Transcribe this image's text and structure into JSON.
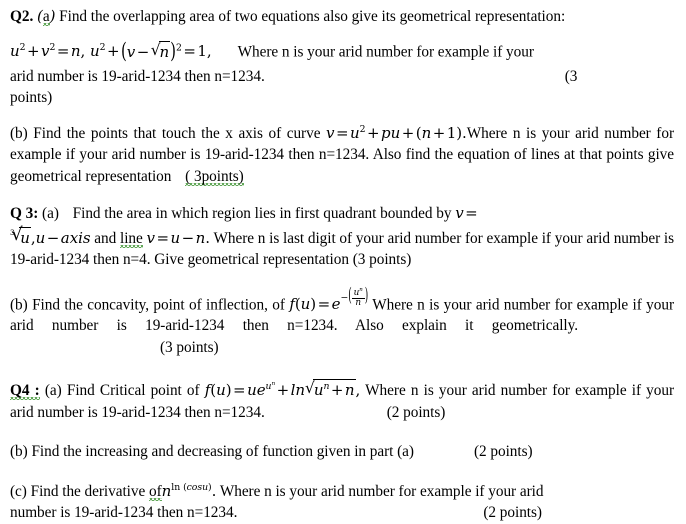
{
  "document": {
    "type": "math-assignment-questions",
    "questions": [
      {
        "id": "q2",
        "label": "Q2.",
        "part_label": "(a)",
        "text_before": "Find the overlapping area of two equations also give its geometrical representation:",
        "equation_plain": "u^2 + v^2 = n,  u^2 + (v - sqrt(n))^2 = 1,",
        "text_after": "Where n is your arid number for example if your arid number is 19-arid-1234 then n=1234.",
        "points": "(3 points)",
        "parts": [
          {
            "id": "q2b",
            "label": "(b)",
            "text_before": "Find the points that touch the x axis of curve",
            "equation_plain": "v = u^2 + pu + (n + 1).",
            "text_after": "Where n is your arid number for example if your arid number is 19-arid-1234 then n=1234. Also find the equation of lines at that points give geometrical representation",
            "points": "( 3points)"
          }
        ]
      },
      {
        "id": "q3",
        "label": "Q 3:",
        "part_label": "(a)",
        "text_before": "Find the area in which region lies in first quadrant bounded by",
        "equation_plain": "v = cbrt(u), u - axis and line v = u - n.",
        "text_after": "Where n is last digit of your arid number for example if your arid number is 19-arid-1234 then n=4. Give geometrical representation",
        "points": "(3 points)",
        "parts": [
          {
            "id": "q3b",
            "label": "(b)",
            "text_before": "Find the concavity, point of inflection, of",
            "equation_plain": "f(u) = e^(-(u^n/n))",
            "text_after": "Where n is your arid number for example if your arid number is 19-arid-1234 then n=1234. Also explain it geometrically.",
            "points": "(3 points)"
          }
        ]
      },
      {
        "id": "q4",
        "label": "Q4 :",
        "part_label": "(a)",
        "text_before": "Find Critical point of",
        "equation_plain": "f(u) = u e^(u^n) + ln sqrt(u^n + n),",
        "text_after": "Where n is your arid number for example if your arid number is 19-arid-1234 then n=1234.",
        "points": "(2 points)",
        "parts": [
          {
            "id": "q4b",
            "label": "(b)",
            "text_before": "Find the increasing and decreasing of function given in part (a)",
            "equation_plain": "",
            "text_after": "",
            "points": "(2 points)"
          },
          {
            "id": "q4c",
            "label": "(c)",
            "text_before": "Find the derivative of",
            "equation_plain": "n^(ln (cos u)).",
            "text_after": "Where n is your arid number for example if your arid number is 19-arid-1234 then n=1234.",
            "points": "(2 points)"
          }
        ]
      }
    ],
    "fragments": {
      "q2_label": "Q2.",
      "q2_a": "a",
      "q2_line1": "Find   the   overlapping   area   of   two   equations   also   give   its   geometrical representation:",
      "q2_where": "Where n is your arid number for example if your",
      "q2_arid": "arid number is 19-arid-1234 then n=1234.",
      "q2_points_open": "(3",
      "q2_points_close": "points)",
      "q2b_label": "(b)",
      "q2b_t1": "Find the points that touch the x axis of curve",
      "q2b_t2": "Where n is your arid number for example if your arid number is 19-arid-1234 then n=1234. Also find the equation of lines at that points give geometrical representation",
      "q2b_points": "( 3points)",
      "q3_label": "Q 3:",
      "q3_a": "(a)",
      "q3_t1": "Find  the  area  in  which  region  lies  in  first  quadrant  bounded  by",
      "q3_and": "and",
      "q3_line": "line",
      "q3_t2": "Where n is last digit of your arid number for example if your arid number is 19-arid-1234 then n=4. Give geometrical representation (3 points)",
      "q3b_label": "(b)",
      "q3b_t1": "Find the concavity, point of inflection, of",
      "q3b_t2": "Where n is your arid number for example if your arid number is 19-arid-1234 then n=1234. Also explain it geometrically.",
      "q3b_points": "(3 points)",
      "q4_label": "Q4",
      "q4_colon": ":",
      "q4_a": "(a)",
      "q4_t1": "Find Critical point of",
      "q4_t2": "Where n is your arid number for example if your arid number is 19-arid-1234 then n=1234.",
      "q4_points": "(2 points)",
      "q4b_label": "(b)",
      "q4b_t1": "Find the increasing and decreasing of function given in part (a)",
      "q4b_points": "(2 points)",
      "q4c_label": "(c)",
      "q4c_t1": "Find the derivative",
      "q4c_of": "of",
      "q4c_t2": "Where n is your arid number for example if your arid",
      "q4c_t3": "number is 19-arid-1234 then n=1234.",
      "q4c_points": "(2 points)"
    },
    "math": {
      "u": "u",
      "v": "v",
      "n": "n",
      "p": "p",
      "e": "e",
      "f": "f",
      "ln": "ln",
      "cos": "cos",
      "axis": "axis",
      "two": "2",
      "one": "1",
      "three": "3",
      "plus": "+",
      "minus": "−",
      "equals": "=",
      "comma": ",",
      "lparen": "(",
      "rparen": ")"
    },
    "colors": {
      "text": "#000000",
      "background": "#ffffff",
      "grammar_underline": "#2e8b22",
      "spelling_underline": "#cc2222"
    }
  }
}
